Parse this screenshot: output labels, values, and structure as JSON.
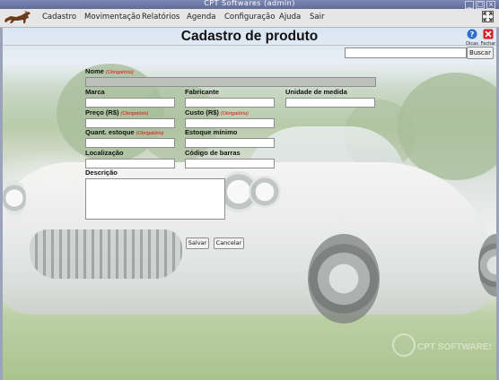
{
  "window": {
    "title": "CPT Softwares (admin)"
  },
  "menubar": {
    "items": [
      {
        "label": "Cadastro"
      },
      {
        "label": "Movimentação"
      },
      {
        "label": "Relatórios"
      },
      {
        "label": "Agenda"
      },
      {
        "label": "Configuração"
      },
      {
        "label": "Ajuda"
      },
      {
        "label": "Sair"
      }
    ]
  },
  "header": {
    "title": "Cadastro de produto",
    "help_label": "Dicas",
    "close_label": "Fechar"
  },
  "search": {
    "value": "",
    "button_label": "Buscar"
  },
  "form": {
    "required_tag": "(Obrigatório)",
    "nome": {
      "label": "Nome",
      "value": ""
    },
    "marca": {
      "label": "Marca",
      "value": ""
    },
    "fabricante": {
      "label": "Fabricante",
      "value": ""
    },
    "unidade": {
      "label": "Unidade de medida",
      "value": ""
    },
    "preco": {
      "label": "Preço (R$)",
      "value": ""
    },
    "custo": {
      "label": "Custo (R$)",
      "value": ""
    },
    "quant_estoque": {
      "label": "Quant. estoque",
      "value": ""
    },
    "estoque_minimo": {
      "label": "Estoque mínimo",
      "value": ""
    },
    "localizacao": {
      "label": "Localização",
      "value": ""
    },
    "codigo_barras": {
      "label": "Código de barras",
      "value": ""
    },
    "descricao": {
      "label": "Descrição",
      "value": ""
    },
    "save_label": "Salvar",
    "cancel_label": "Cancelar"
  },
  "watermark": {
    "text": "CPT SOFTWARES"
  },
  "colors": {
    "titlebar": "#6f7ba6",
    "required": "#dd1111",
    "help": "#2f6fc9",
    "close": "#d42020"
  }
}
